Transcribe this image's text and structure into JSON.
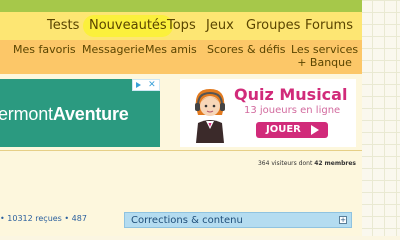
{
  "main_nav": {
    "items": [
      "Tests",
      "Nouveautés",
      "Tops",
      "Jeux",
      "Groupes",
      "Forums"
    ]
  },
  "sub_nav": {
    "items": [
      "Mes favoris",
      "Messagerie",
      "Mes amis",
      "Scores & défis"
    ],
    "services_line1": "Les services",
    "services_line2": "+ Banque"
  },
  "ad_banner": {
    "text_prefix": "ermont",
    "text_bold": "Aventure"
  },
  "quiz_ad": {
    "title": "Quiz Musical",
    "subtitle": "13 joueurs en ligne",
    "button": "JOUER"
  },
  "stats": {
    "visitors_count": "364",
    "visitors_text": "visiteurs dont",
    "members_count": "42",
    "members_text": "membres",
    "user_stats": "• 10312 reçues • 487"
  },
  "side_panel": {
    "title": "Corrections & contenu",
    "expand": "+"
  },
  "colors": {
    "topbar": "#a6c84a",
    "main_nav": "#fde673",
    "sub_nav": "#fcc768",
    "active_tab": "#fbf03c",
    "ad_bg": "#2b9a80",
    "quiz_accent": "#d12b7a",
    "panel": "#b4dcf0"
  }
}
